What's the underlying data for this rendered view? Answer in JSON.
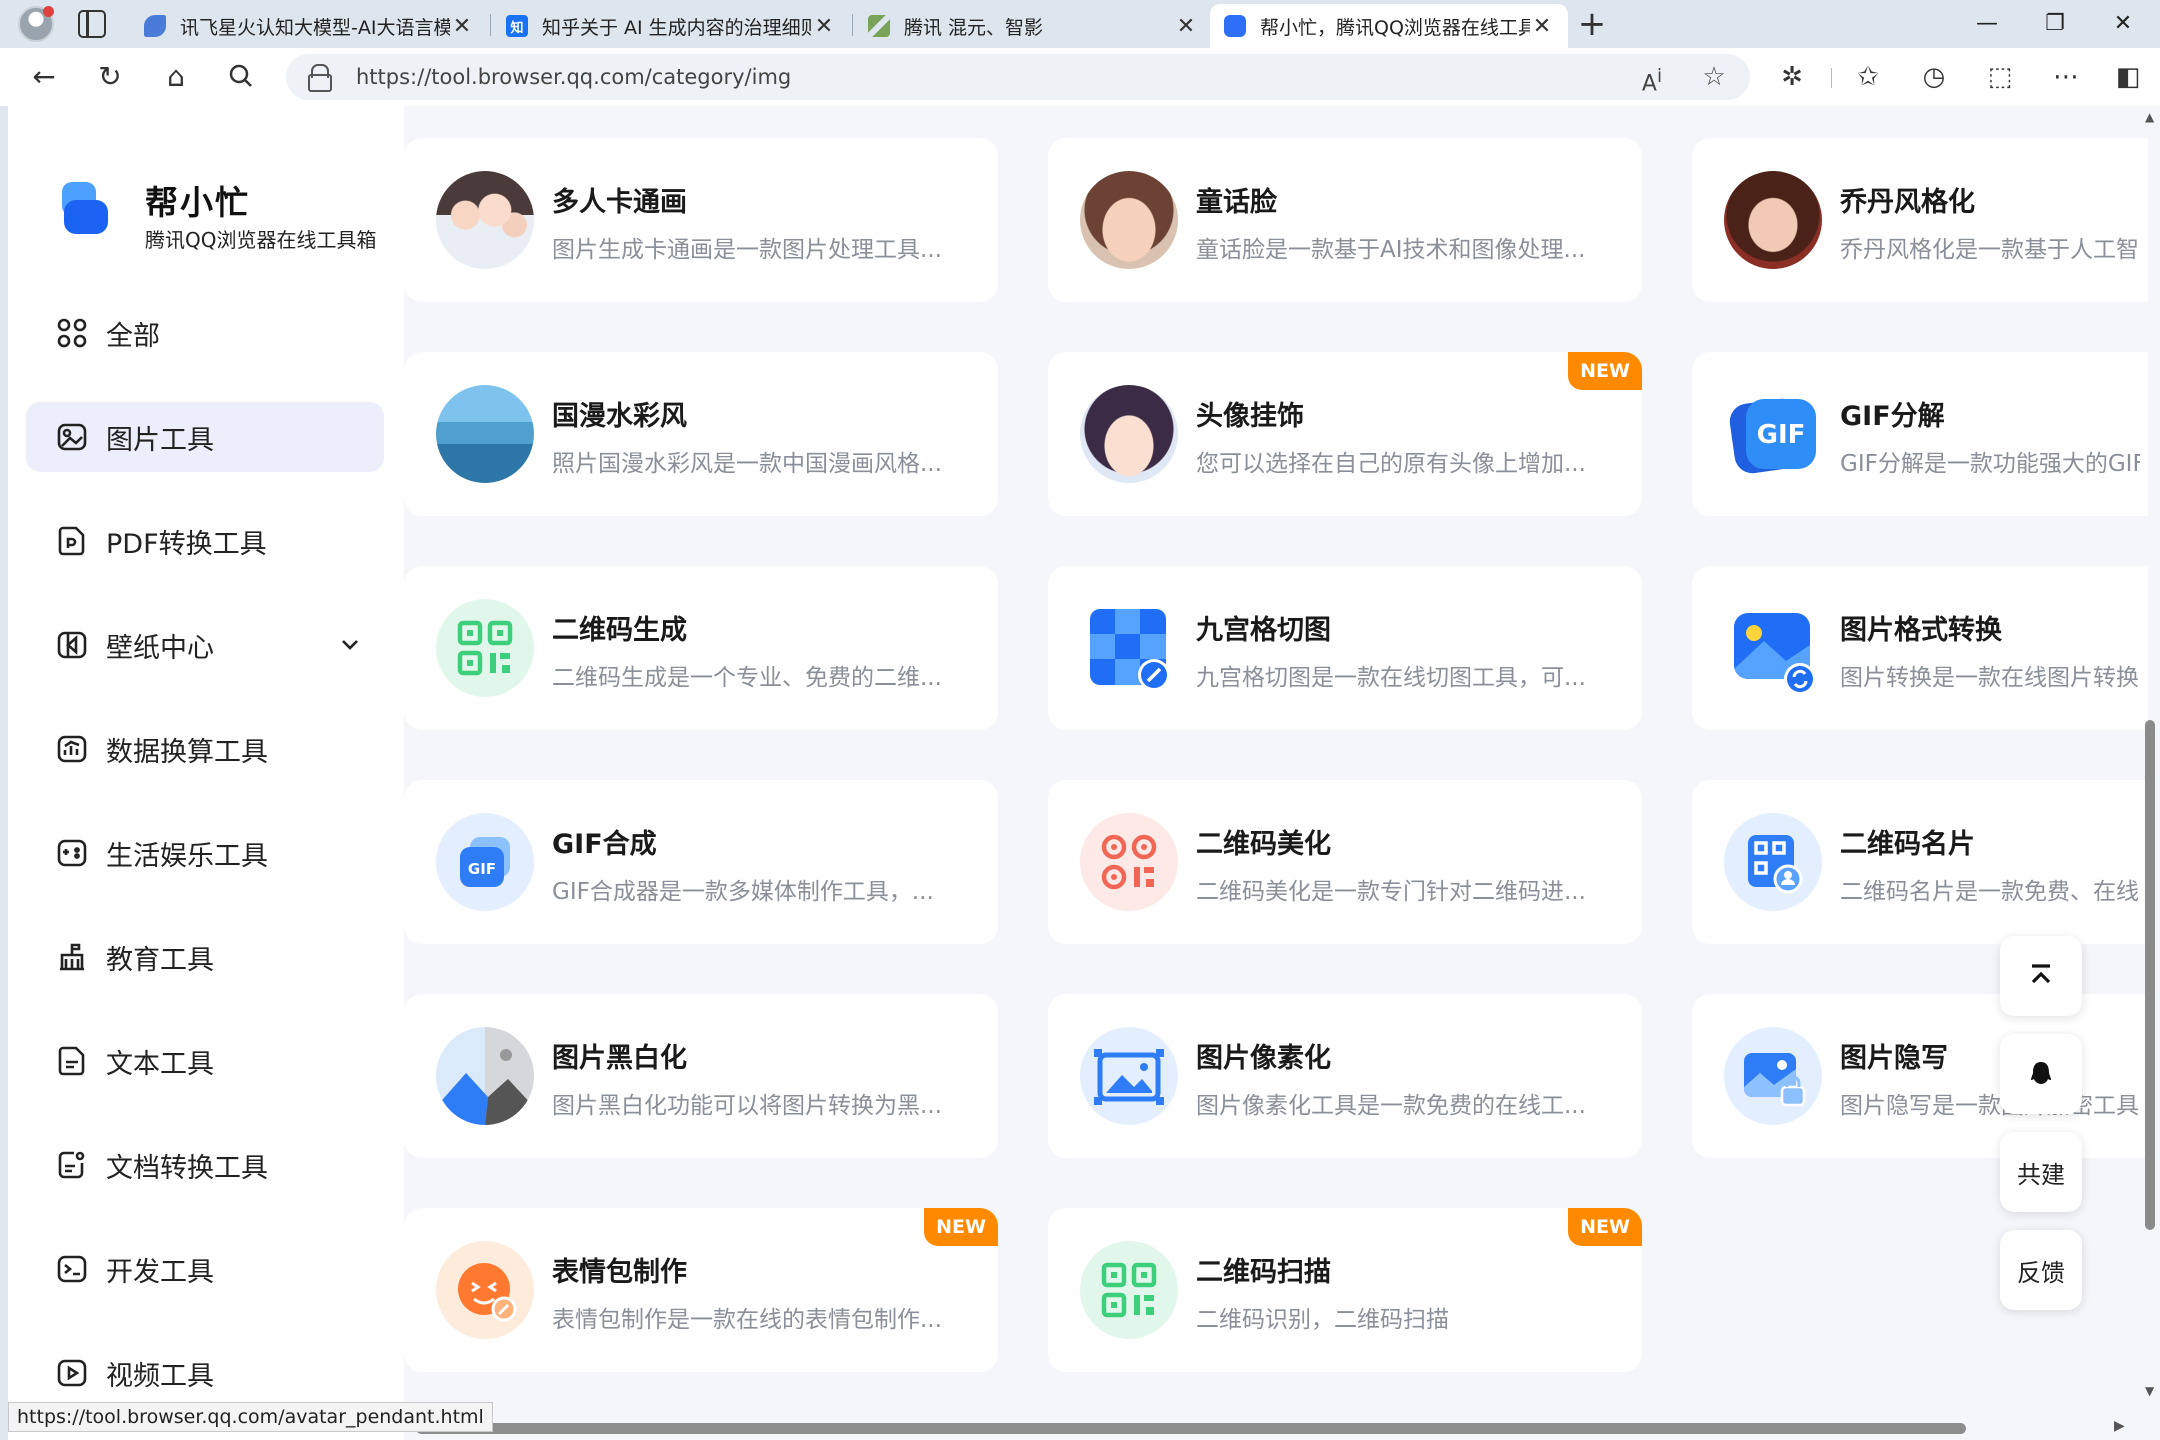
{
  "browser": {
    "tabs": [
      {
        "title": "讯飞星火认知大模型-AI大语言模型",
        "favicon": "spark-icon",
        "color": "#4a7bd8"
      },
      {
        "title": "知乎关于 AI 生成内容的治理细则",
        "favicon": "zhihu-icon",
        "color": "#1772f6",
        "glyph": "知"
      },
      {
        "title": "腾讯 混元、智影",
        "favicon": "pen-icon",
        "color": "#7aa35a"
      },
      {
        "title": "帮小忙，腾讯QQ浏览器在线工具箱",
        "favicon": "bangxiaomang-icon",
        "color": "#2d6ff5",
        "active": true
      }
    ],
    "url": "https://tool.browser.qq.com/category/img",
    "status_url": "https://tool.browser.qq.com/avatar_pendant.html"
  },
  "sidebar": {
    "brand_name": "帮小忙",
    "brand_sub": "腾讯QQ浏览器在线工具箱",
    "items": [
      {
        "label": "全部",
        "icon": "grid-icon"
      },
      {
        "label": "图片工具",
        "icon": "image-icon",
        "active": true
      },
      {
        "label": "PDF转换工具",
        "icon": "pdf-icon"
      },
      {
        "label": "壁纸中心",
        "icon": "wallpaper-icon",
        "expandable": true
      },
      {
        "label": "数据换算工具",
        "icon": "chart-icon"
      },
      {
        "label": "生活娱乐工具",
        "icon": "game-icon"
      },
      {
        "label": "教育工具",
        "icon": "school-icon"
      },
      {
        "label": "文本工具",
        "icon": "text-icon"
      },
      {
        "label": "文档转换工具",
        "icon": "document-icon"
      },
      {
        "label": "开发工具",
        "icon": "terminal-icon"
      },
      {
        "label": "视频工具",
        "icon": "video-icon"
      }
    ]
  },
  "tools": [
    {
      "title": "多人卡通画",
      "desc": "图片生成卡通画是一款图片处理工具...",
      "icon": "cartoon-group-icon"
    },
    {
      "title": "童话脸",
      "desc": "童话脸是一款基于AI技术和图像处理...",
      "icon": "fairy-face-icon"
    },
    {
      "title": "乔丹风格化",
      "desc": "乔丹风格化是一款基于人工智能",
      "icon": "portrait-style-icon"
    },
    {
      "title": "国漫水彩风",
      "desc": "照片国漫水彩风是一款中国漫画风格...",
      "icon": "watercolor-icon"
    },
    {
      "title": "头像挂饰",
      "desc": "您可以选择在自己的原有头像上增加...",
      "icon": "avatar-pendant-icon",
      "badge": "NEW"
    },
    {
      "title": "GIF分解",
      "desc": "GIF分解是一款功能强大的GIF",
      "icon": "gif-split-icon"
    },
    {
      "title": "二维码生成",
      "desc": "二维码生成是一个专业、免费的二维...",
      "icon": "qr-generate-icon"
    },
    {
      "title": "九宫格切图",
      "desc": "九宫格切图是一款在线切图工具，可...",
      "icon": "grid-cut-icon"
    },
    {
      "title": "图片格式转换",
      "desc": "图片转换是一款在线图片转换",
      "icon": "image-convert-icon"
    },
    {
      "title": "GIF合成",
      "desc": "GIF合成器是一款多媒体制作工具，...",
      "icon": "gif-merge-icon"
    },
    {
      "title": "二维码美化",
      "desc": "二维码美化是一款专门针对二维码进...",
      "icon": "qr-beautify-icon"
    },
    {
      "title": "二维码名片",
      "desc": "二维码名片是一款免费、在线",
      "icon": "qr-card-icon"
    },
    {
      "title": "图片黑白化",
      "desc": "图片黑白化功能可以将图片转换为黑...",
      "icon": "bw-image-icon"
    },
    {
      "title": "图片像素化",
      "desc": "图片像素化工具是一款免费的在线工...",
      "icon": "pixelate-icon"
    },
    {
      "title": "图片隐写",
      "desc": "图片隐写是一款图片加密工具",
      "icon": "steganography-icon"
    },
    {
      "title": "表情包制作",
      "desc": "表情包制作是一款在线的表情包制作...",
      "icon": "meme-icon",
      "badge": "NEW"
    },
    {
      "title": "二维码扫描",
      "desc": "二维码识别，二维码扫描",
      "icon": "qr-scan-icon",
      "badge": "NEW"
    }
  ],
  "float_buttons": {
    "cobuild": "共建",
    "feedback": "反馈"
  }
}
